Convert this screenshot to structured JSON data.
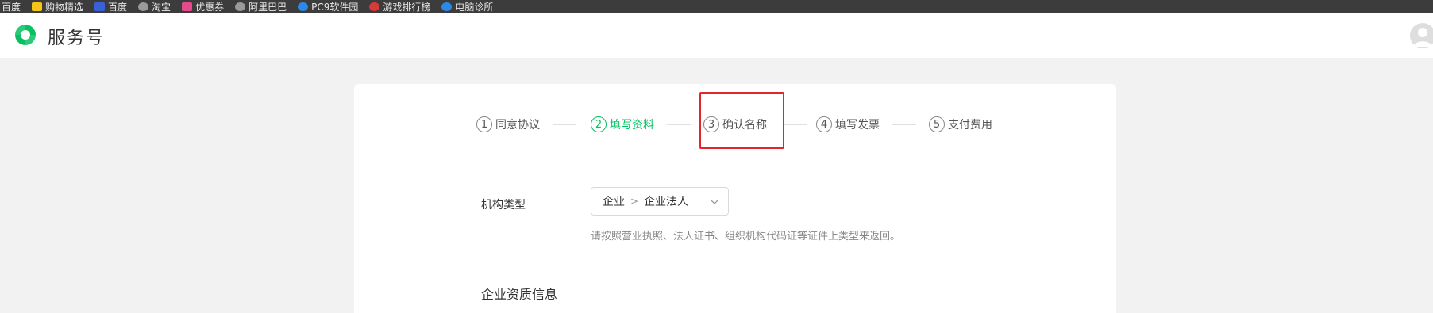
{
  "bookmarks": [
    {
      "label": "百度",
      "icon": "none"
    },
    {
      "label": "购物精选",
      "icon": "folder-icon"
    },
    {
      "label": "百度",
      "icon": "baidu-icon"
    },
    {
      "label": "淘宝",
      "icon": "globe-icon"
    },
    {
      "label": "优惠券",
      "icon": "coupon-icon"
    },
    {
      "label": "阿里巴巴",
      "icon": "globe-icon"
    },
    {
      "label": "PC9软件园",
      "icon": "pc9-icon"
    },
    {
      "label": "游戏排行榜",
      "icon": "game-icon"
    },
    {
      "label": "电脑诊所",
      "icon": "clinic-icon"
    }
  ],
  "header": {
    "brand": "服务号",
    "logo_icon": "wechat-service-logo-icon",
    "avatar_icon": "user-avatar-icon"
  },
  "steps": [
    {
      "num": "1",
      "label": "同意协议",
      "state": "done"
    },
    {
      "num": "2",
      "label": "填写资料",
      "state": "active"
    },
    {
      "num": "3",
      "label": "确认名称",
      "state": "pending"
    },
    {
      "num": "4",
      "label": "填写发票",
      "state": "pending"
    },
    {
      "num": "5",
      "label": "支付费用",
      "state": "pending"
    }
  ],
  "form": {
    "org_type_label": "机构类型",
    "org_type_value_1": "企业",
    "org_type_value_2": "企业法人",
    "hint": "请按照营业执照、法人证书、组织机构代码证等证件上类型来返回。",
    "section_title": "企业资质信息"
  },
  "colors": {
    "accent": "#07c160",
    "highlight": "#e8242b",
    "bookmark_bar": "#3c3c3c",
    "page_bg": "#f2f2f2"
  }
}
